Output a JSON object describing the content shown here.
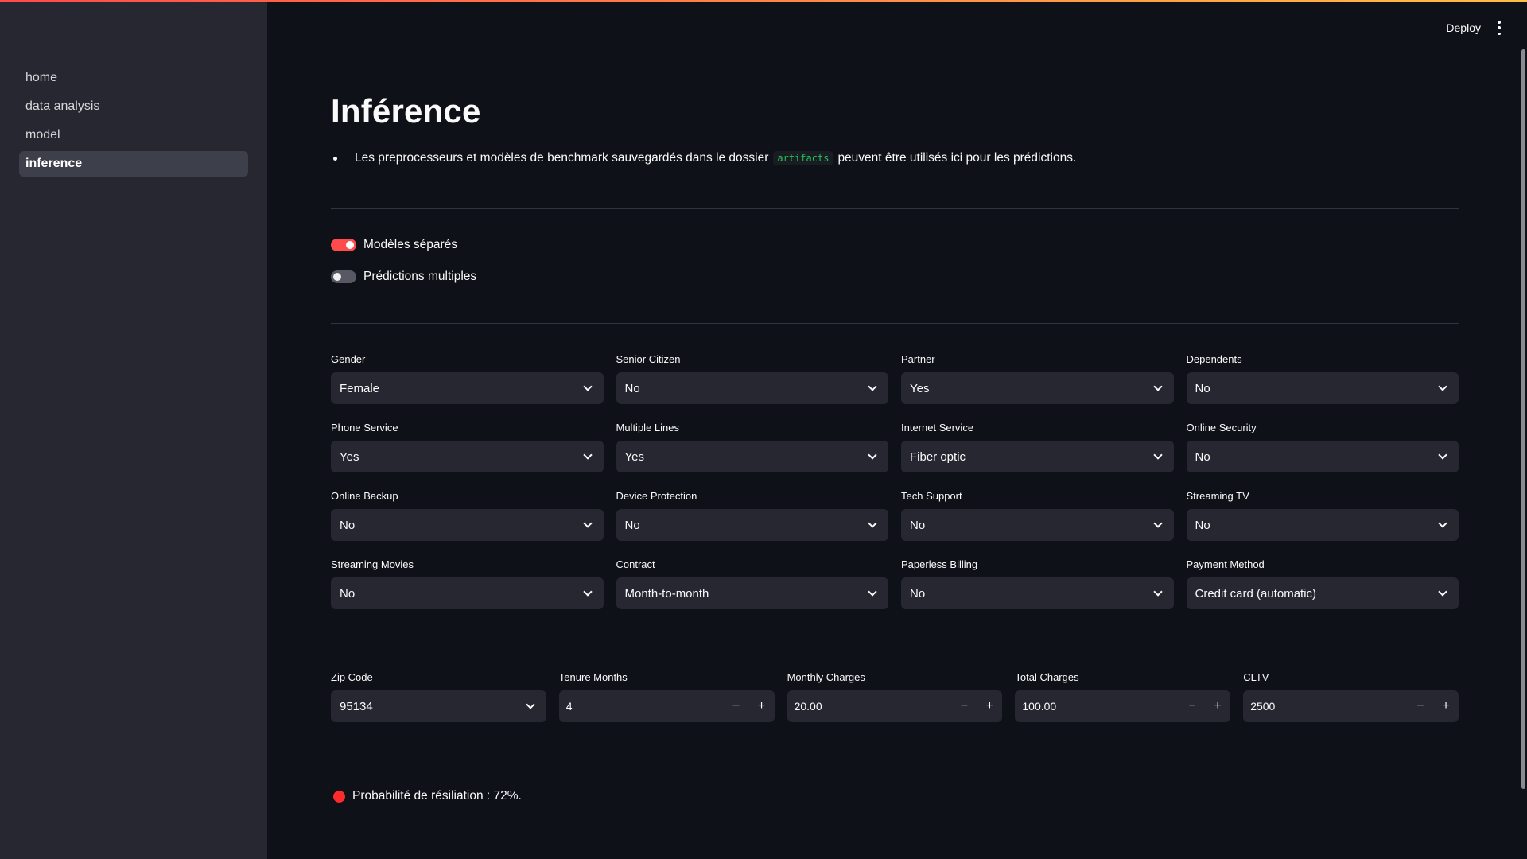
{
  "header": {
    "deploy_label": "Deploy"
  },
  "sidebar": {
    "items": [
      {
        "label": "home"
      },
      {
        "label": "data analysis"
      },
      {
        "label": "model"
      },
      {
        "label": "inference"
      }
    ]
  },
  "main": {
    "title": "Inférence",
    "description": {
      "before": "Les preprocesseurs et modèles de benchmark sauvegardés dans le dossier",
      "code": "artifacts",
      "after": "peuvent être utilisés ici pour les prédictions."
    },
    "toggles": [
      {
        "label": "Modèles séparés",
        "on": true
      },
      {
        "label": "Prédictions multiples",
        "on": false
      }
    ],
    "selects": [
      {
        "label": "Gender",
        "value": "Female"
      },
      {
        "label": "Senior Citizen",
        "value": "No"
      },
      {
        "label": "Partner",
        "value": "Yes"
      },
      {
        "label": "Dependents",
        "value": "No"
      },
      {
        "label": "Phone Service",
        "value": "Yes"
      },
      {
        "label": "Multiple Lines",
        "value": "Yes"
      },
      {
        "label": "Internet Service",
        "value": "Fiber optic"
      },
      {
        "label": "Online Security",
        "value": "No"
      },
      {
        "label": "Online Backup",
        "value": "No"
      },
      {
        "label": "Device Protection",
        "value": "No"
      },
      {
        "label": "Tech Support",
        "value": "No"
      },
      {
        "label": "Streaming TV",
        "value": "No"
      },
      {
        "label": "Streaming Movies",
        "value": "No"
      },
      {
        "label": "Contract",
        "value": "Month-to-month"
      },
      {
        "label": "Paperless Billing",
        "value": "No"
      },
      {
        "label": "Payment Method",
        "value": "Credit card (automatic)"
      }
    ],
    "zip": {
      "label": "Zip Code",
      "value": "95134"
    },
    "numbers": [
      {
        "label": "Tenure Months",
        "value": "4"
      },
      {
        "label": "Monthly Charges",
        "value": "20.00"
      },
      {
        "label": "Total Charges",
        "value": "100.00"
      },
      {
        "label": "CLTV",
        "value": "2500"
      }
    ],
    "stepper": {
      "minus": "−",
      "plus": "+"
    },
    "result": "Probabilité de résiliation : 72%.",
    "colors": {
      "accent": "#ff4b4b",
      "background": "#0e1117",
      "sidebar": "#262730",
      "code": "#21c354"
    }
  }
}
